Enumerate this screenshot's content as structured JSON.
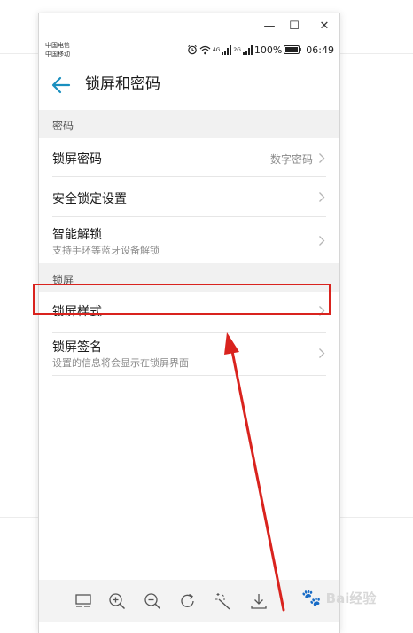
{
  "window": {
    "minimize_glyph": "—",
    "maximize_glyph": "☐",
    "close_glyph": "✕"
  },
  "status_bar": {
    "carrier_1": "中国电信",
    "carrier_2": "中国移动",
    "network_1": "4G",
    "network_2": "2G",
    "battery": "100%",
    "time": "06:49",
    "icons": [
      "alarm-icon",
      "wifi-icon",
      "signal-icon",
      "battery-icon"
    ]
  },
  "app_bar": {
    "title": "锁屏和密码",
    "back_icon": "arrow-left-icon",
    "accent": "#1a8fbf"
  },
  "sections": [
    {
      "header": "密码",
      "items": [
        {
          "title": "锁屏密码",
          "value": "数字密码",
          "subtitle": ""
        },
        {
          "title": "安全锁定设置",
          "value": "",
          "subtitle": ""
        },
        {
          "title": "智能解锁",
          "value": "",
          "subtitle": "支持手环等蓝牙设备解锁"
        }
      ]
    },
    {
      "header": "锁屏",
      "items": [
        {
          "title": "锁屏样式",
          "value": "",
          "subtitle": ""
        },
        {
          "title": "锁屏签名",
          "value": "",
          "subtitle": "设置的信息将会显示在锁屏界面"
        }
      ]
    }
  ],
  "bottom_toolbar": {
    "icons": [
      "fit-screen-icon",
      "zoom-in-icon",
      "zoom-out-icon",
      "rotate-icon",
      "magic-wand-icon",
      "download-icon"
    ]
  },
  "annotation": {
    "highlight_color": "#d9231e",
    "target": "锁屏样式"
  },
  "watermark": {
    "text": "Bai经验",
    "paw": "🐾"
  }
}
